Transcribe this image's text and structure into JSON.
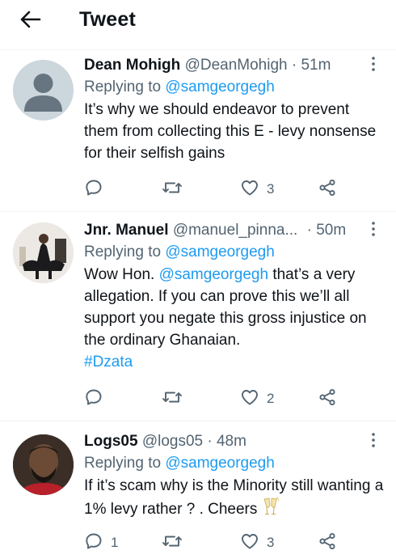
{
  "header": {
    "title": "Tweet"
  },
  "tweets": [
    {
      "name": "Dean Mohigh",
      "handle": "@DeanMohigh",
      "time": "51m",
      "replying_label": "Replying to",
      "replying_to": "@samgeorgegh",
      "text": "It’s why we should endeavor to prevent them from collecting this E - levy nonsense for their selfish gains",
      "reply_count": "",
      "retweet_count": "",
      "like_count": "3"
    },
    {
      "name": "Jnr. Manuel",
      "handle": "@manuel_pinna...",
      "time": "50m",
      "replying_label": "Replying to",
      "replying_to": "@samgeorgegh",
      "text_before": "Wow Hon. ",
      "text_mention": "@samgeorgegh",
      "text_after": " that’s a very allegation. If you can prove this we’ll all support you negate this gross injustice on the ordinary Ghanaian.",
      "hashtag": "#Dzata",
      "reply_count": "",
      "retweet_count": "",
      "like_count": "2"
    },
    {
      "name": "Logs05",
      "handle": "@logs05",
      "time": "48m",
      "replying_label": "Replying to",
      "replying_to": "@samgeorgegh",
      "text": "If it’s scam why is the Minority still wanting a 1% levy rather ? . Cheers",
      "reply_count": "1",
      "retweet_count": "",
      "like_count": "3"
    }
  ],
  "meta_separator": "·",
  "icons": {
    "back": "arrow-left-icon",
    "more": "more-vertical-icon",
    "reply": "reply-icon",
    "retweet": "retweet-icon",
    "like": "heart-icon",
    "share": "share-icon",
    "emoji": "clinking-glasses-emoji"
  },
  "colors": {
    "accent": "#1d9bf0",
    "secondary_text": "#536471",
    "divider": "#eff3f4"
  }
}
